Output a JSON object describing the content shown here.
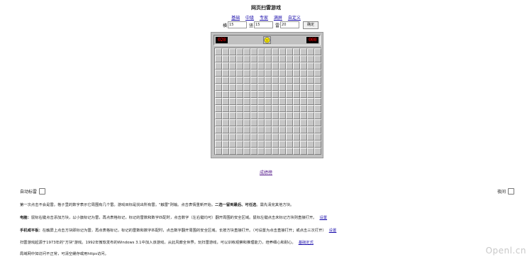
{
  "title": "网页扫雷游戏",
  "levels": [
    "基础",
    "中级",
    "专家",
    "满屏",
    "自定义"
  ],
  "custom": {
    "width_label": "横",
    "width_value": "15",
    "height_label": "竖",
    "height_value": "15",
    "mines_label": "雷",
    "mines_value": "20",
    "confirm": "确定"
  },
  "game": {
    "mines_left": "020",
    "timer": "000",
    "rows": 15,
    "cols": 15,
    "face": "smiley"
  },
  "score_link": "成绩榜",
  "options": {
    "auto_flag": "自动标雷",
    "night": "夜间"
  },
  "help": {
    "line1_a": "第一次点击不会是雷。格子里的数字表示它周围有几个雷。游戏目标是找出所有雷。\"触雷\"则输。点击表情重新开始。",
    "line1_b": "二选一留到最后、可任选",
    "line1_c": "。需先清完其他方块。",
    "pc_label": "电脑：",
    "pc_text": "鼠标右键点击添加方块，以小旗标记为雷，再点表格标记，标记的雷数和数字匹配时，点击数字（左右键均可）翻开周围的安全区域。鼠标左键点击未标记方块则直接打开。",
    "pc_link": "设置",
    "mobile_label": "手机或平板：",
    "mobile_text": "在触屏上点击方块即标记为雷，再点表格标记，标记的雷数和数字匹配时，点击数字翻开周围的安全区域。长按方块直接打开。（可设置为点击直接打开；或点击三次打开）",
    "mobile_link": "设置",
    "history_text": "扫雷游戏起源于1973年的\"方块\"游戏。1992年微软发布的Windows 3.1中加入该游戏，从此风靡全世界。玩扫雷游戏，可以训练观察和推理能力，培养细心和耐心。",
    "history_link": "基础定式",
    "lan_text": "局域网中如访问不正常，可清空缓存或用https访问。"
  },
  "watermark": "Openl.cn"
}
